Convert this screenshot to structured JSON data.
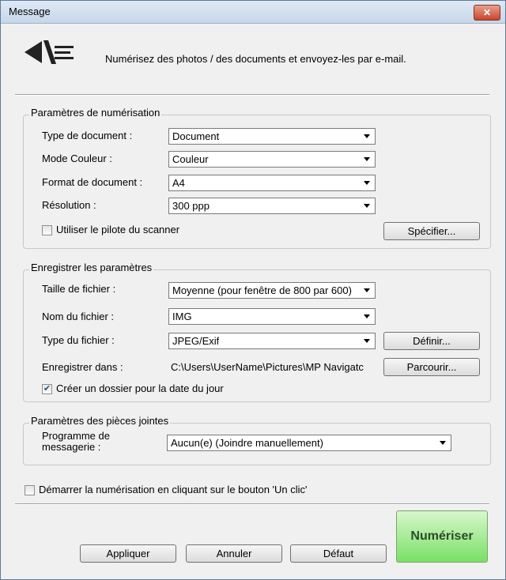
{
  "window": {
    "title": "Message",
    "close_label": "✕"
  },
  "header": {
    "description": "Numérisez des photos / des documents et envoyez-les par e-mail."
  },
  "scan_settings": {
    "title": "Paramètres de numérisation",
    "document_type_label": "Type de document :",
    "document_type_value": "Document",
    "color_mode_label": "Mode Couleur :",
    "color_mode_value": "Couleur",
    "document_size_label": "Format de document :",
    "document_size_value": "A4",
    "resolution_label": "Résolution :",
    "resolution_value": "300 ppp",
    "use_driver_label": "Utiliser le pilote du scanner",
    "use_driver_checked": false,
    "specify_button": "Spécifier..."
  },
  "save_settings": {
    "title": "Enregistrer les paramètres",
    "file_size_label": "Taille de fichier :",
    "file_size_value": "Moyenne (pour fenêtre de 800 par 600)",
    "file_name_label": "Nom du fichier :",
    "file_name_value": "IMG",
    "file_type_label": "Type du fichier :",
    "file_type_value": "JPEG/Exif",
    "set_button": "Définir...",
    "save_in_label": "Enregistrer dans :",
    "save_in_value": "C:\\Users\\UserName\\Pictures\\MP Navigatc",
    "browse_button": "Parcourir...",
    "create_folder_label": "Créer un dossier pour la date du jour",
    "create_folder_checked": true
  },
  "attachment_settings": {
    "title": "Paramètres des pièces jointes",
    "mail_program_label_line1": "Programme de",
    "mail_program_label_line2": "messagerie :",
    "mail_program_value": "Aucun(e) (Joindre manuellement)"
  },
  "one_click": {
    "label": "Démarrer la numérisation en cliquant sur le bouton 'Un clic'",
    "checked": false
  },
  "footer": {
    "apply": "Appliquer",
    "cancel": "Annuler",
    "default": "Défaut",
    "scan": "Numériser"
  }
}
